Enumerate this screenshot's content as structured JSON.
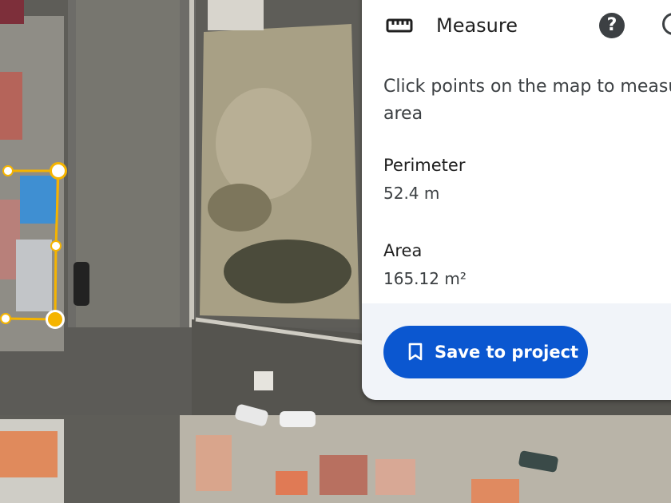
{
  "panel": {
    "title": "Measure",
    "title_icon": "ruler-icon",
    "help_icon": "help-icon",
    "close_icon": "close-icon",
    "instructions": "Click points on the map to measure area",
    "perimeter": {
      "label": "Perimeter",
      "value": "52.4 m"
    },
    "area": {
      "label": "Area",
      "value": "165.12 m²"
    },
    "save_button": {
      "label": "Save to project",
      "icon": "bookmark-icon"
    }
  },
  "colors": {
    "accent": "#0b57d0",
    "measure_line": "#f5b400",
    "panel_bg": "#ffffff",
    "footer_bg": "#f1f4f9"
  }
}
